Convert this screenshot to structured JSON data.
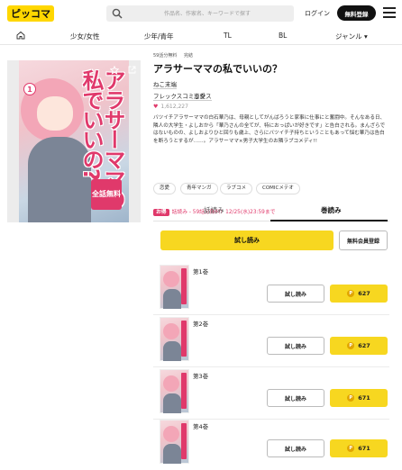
{
  "header": {
    "logo": "ピッコマ",
    "search_placeholder": "作品名、作家名、キーワードで探す",
    "login_label": "ログイン",
    "register_label": "無料登録"
  },
  "nav": {
    "items": [
      "少女/女性",
      "少年/青年",
      "TL",
      "BL",
      "ジャンル ▾"
    ]
  },
  "cover": {
    "title_vertical": "アラサーママの私でいいの?",
    "volume_mark": "1",
    "badge": "全話無料"
  },
  "info": {
    "meta": [
      "59話分無料",
      "完結"
    ],
    "title": "アラサーママの私でいいの？",
    "author": "ねこ末端",
    "publisher": "フレックスコミックス",
    "genre": "恋愛",
    "likes": "1,612,227",
    "description": "バツイチアラサーママの白石華乃は、母親としてがんばろうと家事に仕事にと奮闘中。そんなある日、隣人の大学生・よしおから「華乃さんの全てが、特におっぱいが好きです」と告白される。まんざらではないものの、よしおよりひと回りも歳上、さらにバツイチ子持ちということもあって悩む華乃は告白を断ろうとするが……。アラサーママ×男子大学生のお隣ラブコメディ!!",
    "tags": [
      "恋愛",
      "青年マンガ",
      "ラブコメ",
      "COMICメテオ"
    ],
    "promo_badge": "お得",
    "promo_text": "話読み - 59話分無料！12/25(水)23:59まで"
  },
  "tabs": {
    "episodes_label": "話読み",
    "volumes_label": "巻読み"
  },
  "actions": {
    "read_label": "試し読み",
    "free_register_label": "無料会員登録"
  },
  "volumes": [
    {
      "label": "第1巻",
      "read": "試し読み",
      "price": "627"
    },
    {
      "label": "第2巻",
      "read": "試し読み",
      "price": "627"
    },
    {
      "label": "第3巻",
      "read": "試し読み",
      "price": "671"
    },
    {
      "label": "第4巻",
      "read": "試し読み",
      "price": "671"
    }
  ],
  "colors": {
    "brand_yellow": "#f7d720",
    "accent_pink": "#e0396b",
    "coin": "#e1a500"
  }
}
